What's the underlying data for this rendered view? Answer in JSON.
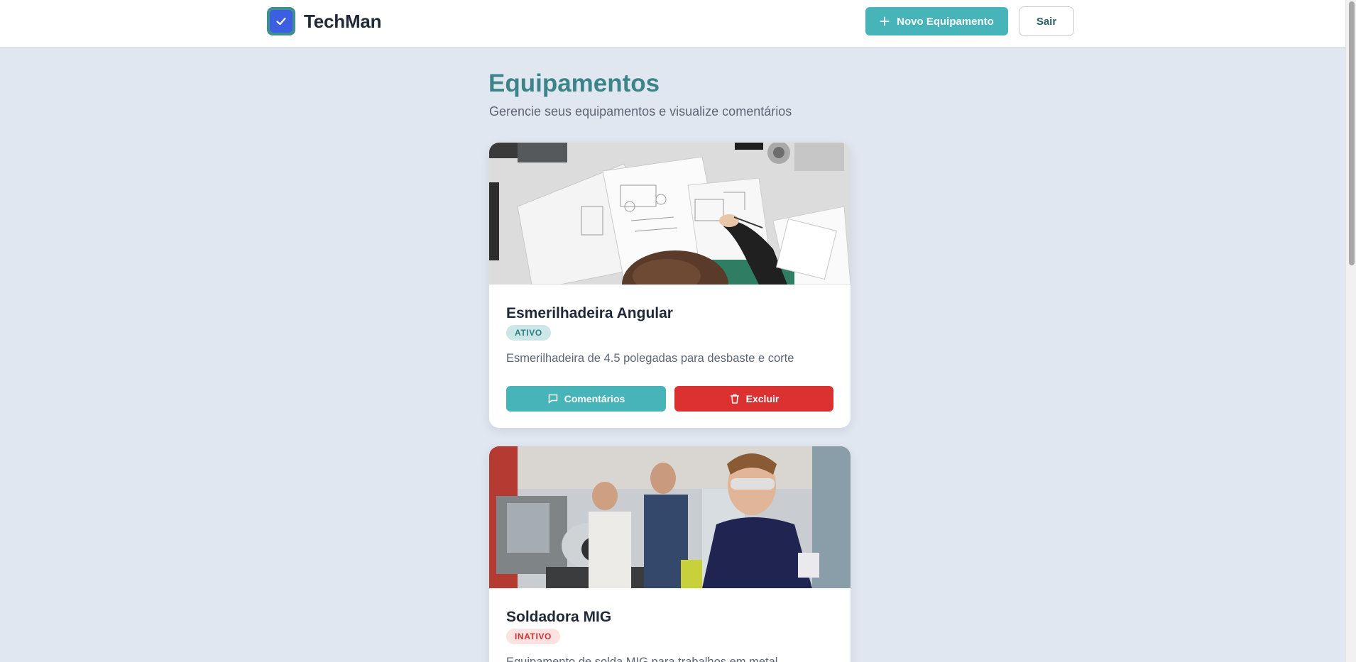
{
  "header": {
    "brand_name": "TechMan",
    "brand_icon": "check-icon",
    "new_equipment_label": "Novo Equipamento",
    "exit_label": "Sair"
  },
  "main": {
    "title": "Equipamentos",
    "subtitle": "Gerencie seus equipamentos e visualize comentários"
  },
  "equipment": [
    {
      "name": "Esmerilhadeira Angular",
      "status": "ATIVO",
      "description": "Esmerilhadeira de 4.5 polegadas para desbaste e corte",
      "comments_label": "Comentários",
      "delete_label": "Excluir",
      "image": "engineering-drawings-photo"
    },
    {
      "name": "Soldadora MIG",
      "status": "INATIVO",
      "description": "Equipamento de solda MIG para trabalhos em metal",
      "image": "workshop-students-photo"
    }
  ],
  "colors": {
    "accent": "#47b4b9",
    "title": "#3c8489",
    "danger": "#dc3131",
    "background": "#e1e7f0",
    "logo": "#3b5fe0"
  }
}
